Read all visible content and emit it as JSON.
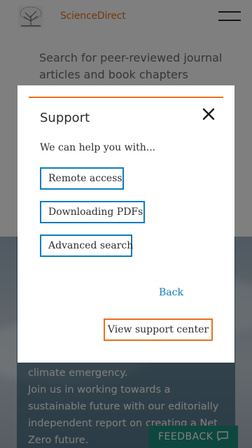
{
  "header": {
    "brand_name": "ScienceDirect",
    "brand_color": "#e9711c",
    "menu_icon": "hamburger-menu-icon",
    "logo_icon": "elsevier-tree-logo"
  },
  "search": {
    "intro_text": "Search for peer-reviewed journal articles and book chapters (including"
  },
  "hero": {
    "text_line_1": "climate emergency.",
    "text_line_2": "Join us in working towards a sustainable future with our editorially independent report on creating a Net Zero future."
  },
  "feedback": {
    "label": "FEEDBACK",
    "icon": "speech-bubble-icon",
    "color": "#1d8e7e"
  },
  "modal": {
    "title": "Support",
    "close_icon": "close-x-icon",
    "subtitle": "We can help you with...",
    "options": [
      {
        "label": "Remote access"
      },
      {
        "label": "Downloading PDFs"
      },
      {
        "label": "Advanced search"
      }
    ],
    "back_label": "Back",
    "support_center_label": "View support center",
    "accent_color": "#e9711c",
    "link_color": "#0c7dbb"
  }
}
